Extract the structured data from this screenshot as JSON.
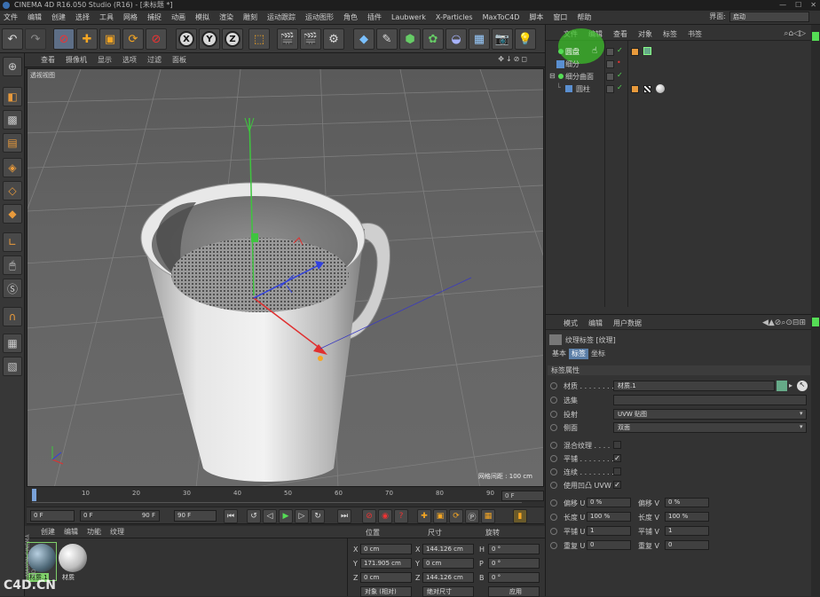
{
  "window": {
    "title": "CINEMA 4D R16.050 Studio (R16) - [未标题 *]"
  },
  "menubar": {
    "items": [
      "文件",
      "编辑",
      "创建",
      "选择",
      "工具",
      "网格",
      "捕捉",
      "动画",
      "模拟",
      "渲染",
      "雕刻",
      "运动跟踪",
      "运动图形",
      "角色",
      "插件",
      "Laubwerk",
      "X-Particles",
      "MaxToC4D",
      "脚本",
      "窗口",
      "帮助"
    ],
    "layout_label": "界面:",
    "layout_value": "启动"
  },
  "viewport": {
    "menu": [
      "查看",
      "摄像机",
      "显示",
      "选项",
      "过滤",
      "面板"
    ],
    "label": "透视视图",
    "grid_info": "网格间距 : 100 cm"
  },
  "timeline": {
    "ticks": [
      "0",
      "10",
      "20",
      "30",
      "40",
      "50",
      "60",
      "70",
      "80",
      "90"
    ],
    "current_frame": "0 F"
  },
  "playback": {
    "start": "0 F",
    "range_start": "0 F",
    "range_end": "90 F",
    "end": "90 F"
  },
  "material_manager": {
    "menu": [
      "创建",
      "编辑",
      "功能",
      "纹理"
    ],
    "materials": [
      {
        "name": "材质.1"
      },
      {
        "name": "材质"
      }
    ]
  },
  "coordinates": {
    "headers": {
      "position": "位置",
      "size": "尺寸",
      "rotation": "旋转"
    },
    "rows": [
      {
        "axis": "X",
        "pos": "0 cm",
        "size_axis": "X",
        "size": "144.126 cm",
        "rot_axis": "H",
        "rot": "0 °"
      },
      {
        "axis": "Y",
        "pos": "171.905 cm",
        "size_axis": "Y",
        "size": "0 cm",
        "rot_axis": "P",
        "rot": "0 °"
      },
      {
        "axis": "Z",
        "pos": "0 cm",
        "size_axis": "Z",
        "size": "144.126 cm",
        "rot_axis": "B",
        "rot": "0 °"
      }
    ],
    "mode": "对象 (相对)",
    "size_mode": "绝对尺寸",
    "apply": "应用"
  },
  "object_manager": {
    "menu": [
      "文件",
      "编辑",
      "查看",
      "对象",
      "标签",
      "书签"
    ],
    "objects": [
      {
        "name": "圆盘",
        "indent": 0,
        "selected": true
      },
      {
        "name": "细分",
        "indent": 0,
        "selected": false
      },
      {
        "name": "细分曲面",
        "indent": 0,
        "selected": false
      },
      {
        "name": "圆柱",
        "indent": 1,
        "selected": false
      }
    ]
  },
  "attribute_manager": {
    "menu": [
      "模式",
      "编辑",
      "用户数据"
    ],
    "title": "纹理标签 [纹理]",
    "tabs": [
      "基本",
      "标签",
      "坐标"
    ],
    "active_tab": "标签",
    "section": "标签属性",
    "fields": [
      {
        "label": "材质 . . . . . . . .",
        "value": "材质.1"
      },
      {
        "label": "选集",
        "value": ""
      },
      {
        "label": "投射",
        "value": "UVW 贴图"
      },
      {
        "label": "侧面",
        "value": "双面"
      }
    ],
    "checks": [
      {
        "label": "混合纹理 . . . .",
        "checked": false
      },
      {
        "label": "平铺 . . . . . . . .",
        "checked": true
      },
      {
        "label": "连续 . . . . . . . .",
        "checked": false
      },
      {
        "label": "使用凹凸 UVW",
        "checked": true
      }
    ],
    "numeric": [
      {
        "l1": "偏移 U",
        "v1": "0 %",
        "l2": "偏移 V",
        "v2": "0 %"
      },
      {
        "l1": "长度 U",
        "v1": "100 %",
        "l2": "长度 V",
        "v2": "100 %"
      },
      {
        "l1": "平铺 U",
        "v1": "1",
        "l2": "平铺 V",
        "v2": "1"
      },
      {
        "l1": "重复 U",
        "v1": "0",
        "l2": "重复 V",
        "v2": "0"
      }
    ]
  },
  "watermark": "C4D.CN",
  "watermark_side": "MAXON CINEMA 4D"
}
